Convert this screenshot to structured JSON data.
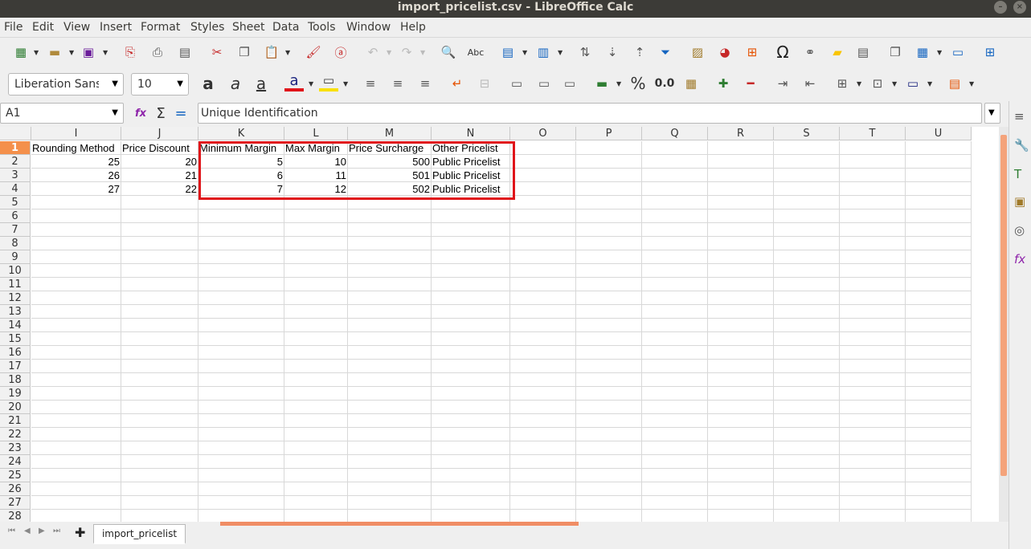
{
  "window": {
    "title": "import_pricelist.csv - LibreOffice Calc"
  },
  "menu": [
    "File",
    "Edit",
    "View",
    "Insert",
    "Format",
    "Styles",
    "Sheet",
    "Data",
    "Tools",
    "Window",
    "Help"
  ],
  "format_toolbar": {
    "font_name": "Liberation Sans",
    "font_size": "10",
    "percent_label": "%",
    "number_label": "0.0"
  },
  "formula_bar": {
    "cell_ref": "A1",
    "content": "Unique Identification",
    "sum_symbol": "Σ",
    "equals_symbol": "=",
    "fx_symbol": "fx"
  },
  "columns": [
    "I",
    "J",
    "K",
    "L",
    "M",
    "N",
    "O",
    "P",
    "Q",
    "R",
    "S",
    "T",
    "U"
  ],
  "rows": [
    "1",
    "2",
    "3",
    "4",
    "5",
    "6",
    "7",
    "8",
    "9",
    "10",
    "11",
    "12",
    "13",
    "14",
    "15",
    "16",
    "17",
    "18",
    "19",
    "20",
    "21",
    "22",
    "23",
    "24",
    "25",
    "26",
    "27",
    "28"
  ],
  "cells": [
    [
      "Rounding Method",
      "Price Discount",
      "Minimum Margin",
      "Max Margin",
      "Price Surcharge",
      "Other Pricelist"
    ],
    [
      "25",
      "20",
      "5",
      "10",
      "500",
      "Public Pricelist"
    ],
    [
      "26",
      "21",
      "6",
      "11",
      "501",
      "Public Pricelist"
    ],
    [
      "27",
      "22",
      "7",
      "12",
      "502",
      "Public Pricelist"
    ]
  ],
  "sheet_tab": "import_pricelist",
  "colors": {
    "accent": "#f4904b",
    "highlight_box": "#e0141a",
    "titlebar": "#3c3b37"
  }
}
